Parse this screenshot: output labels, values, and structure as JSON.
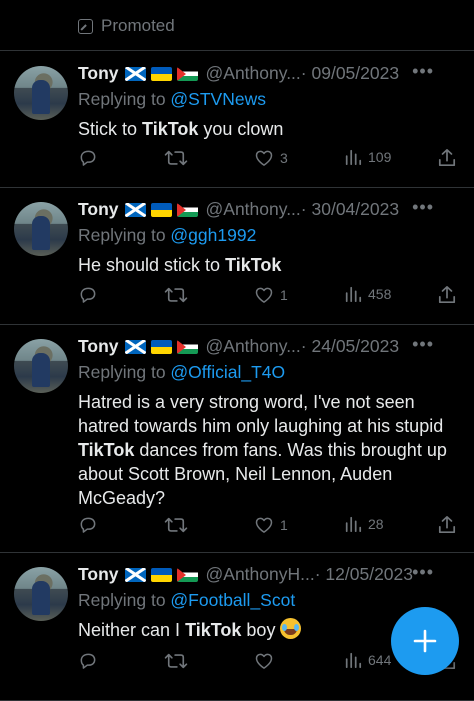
{
  "promoted_label": "Promoted",
  "tweets": [
    {
      "name": "Tony",
      "handle": "@Anthony...",
      "date": "· 09/05/2023",
      "replying_prefix": "Replying to ",
      "replying_to": "@STVNews",
      "body": [
        "Stick to ",
        {
          "b": "TikTok"
        },
        " you clown"
      ],
      "likes": "3",
      "views": "109",
      "retweets": ""
    },
    {
      "name": "Tony",
      "handle": "@Anthony...",
      "date": "· 30/04/2023",
      "replying_prefix": "Replying to ",
      "replying_to": "@ggh1992",
      "body": [
        "He should stick to ",
        {
          "b": "TikTok"
        }
      ],
      "likes": "1",
      "views": "458",
      "retweets": ""
    },
    {
      "name": "Tony",
      "handle": "@Anthony...",
      "date": "· 24/05/2023",
      "replying_prefix": "Replying to ",
      "replying_to": "@Official_T4O",
      "body": [
        "Hatred is a very strong word, I've not seen hatred towards him only laughing at his stupid ",
        {
          "b": "TikTok"
        },
        " dances from fans. Was this brought up about Scott Brown, Neil Lennon, Auden McGeady?"
      ],
      "likes": "1",
      "views": "28",
      "retweets": ""
    },
    {
      "name": "Tony",
      "handle": "@AnthonyH...",
      "date": "· 12/05/2023",
      "replying_prefix": "Replying to ",
      "replying_to": "@Football_Scot",
      "body": [
        "Neither can I ",
        {
          "b": "TikTok"
        },
        " boy "
      ],
      "likes": "",
      "views": "644",
      "retweets": ""
    }
  ],
  "icons": {
    "reply": "reply-icon",
    "retweet": "retweet-icon",
    "like": "heart-icon",
    "views": "views-icon",
    "share": "share-icon",
    "compose": "compose-plus-icon",
    "more": "more-icon",
    "promoted": "promoted-icon"
  },
  "colors": {
    "background": "#000000",
    "text": "#e7e9ea",
    "muted": "#71767b",
    "link": "#1d9bf0",
    "divider": "#2f3336"
  }
}
